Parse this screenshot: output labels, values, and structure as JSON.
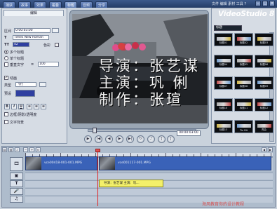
{
  "menu": {
    "tabs": [
      "捕获",
      "故事",
      "效果",
      "覆叠",
      "标题",
      "音频",
      "分享"
    ],
    "active_tab": "标题",
    "file_menu": "文件 编辑 素材 工具 ?"
  },
  "brand": "VideoStudio 8",
  "options": {
    "tab": "编辑",
    "duration_label": "区间",
    "duration_value": "0:00:03:00",
    "font_value": "Times New Roman",
    "size_value": "42",
    "color_label": "色彩",
    "multi_title_label": "多个标题",
    "single_title_label": "单个标题",
    "vertical_label": "垂直文字",
    "line_spacing_value": "100",
    "animation_label": "动画",
    "type_label": "类型",
    "type_value": "飞行",
    "preset_label": "预设",
    "bold_glyph": "B",
    "italic_glyph": "I",
    "underline_glyph": "U",
    "border_label": "边框/阴影/透明度",
    "text_bg_label": "文字背景"
  },
  "preview": {
    "captions": [
      "导演：张艺谋",
      "主演：巩 俐",
      "制作：张瑄"
    ],
    "timecode": "00:00:03:00"
  },
  "library": {
    "selected": "标题",
    "items": [
      {
        "label": "标题01"
      },
      {
        "label": "标题02"
      },
      {
        "label": "标题03"
      },
      {
        "label": "标题04"
      },
      {
        "label": "标题05"
      },
      {
        "label": "标题06"
      },
      {
        "label": "标题07"
      },
      {
        "label": "标题08"
      },
      {
        "label": "标题09"
      },
      {
        "label": "标题10"
      },
      {
        "label": "标题11"
      },
      {
        "label": "标题12"
      },
      {
        "label": "标题13"
      },
      {
        "label": "Tin Bit"
      },
      {
        "label": "再会"
      }
    ]
  },
  "timeline": {
    "clips": [
      {
        "name": "vce00418-001-001.MPG"
      },
      {
        "name": "vce001117-001.MPG"
      }
    ],
    "title_clip": "导演：张艺谋 主演：巩..."
  },
  "watermark": "海风教育你的设计教程"
}
